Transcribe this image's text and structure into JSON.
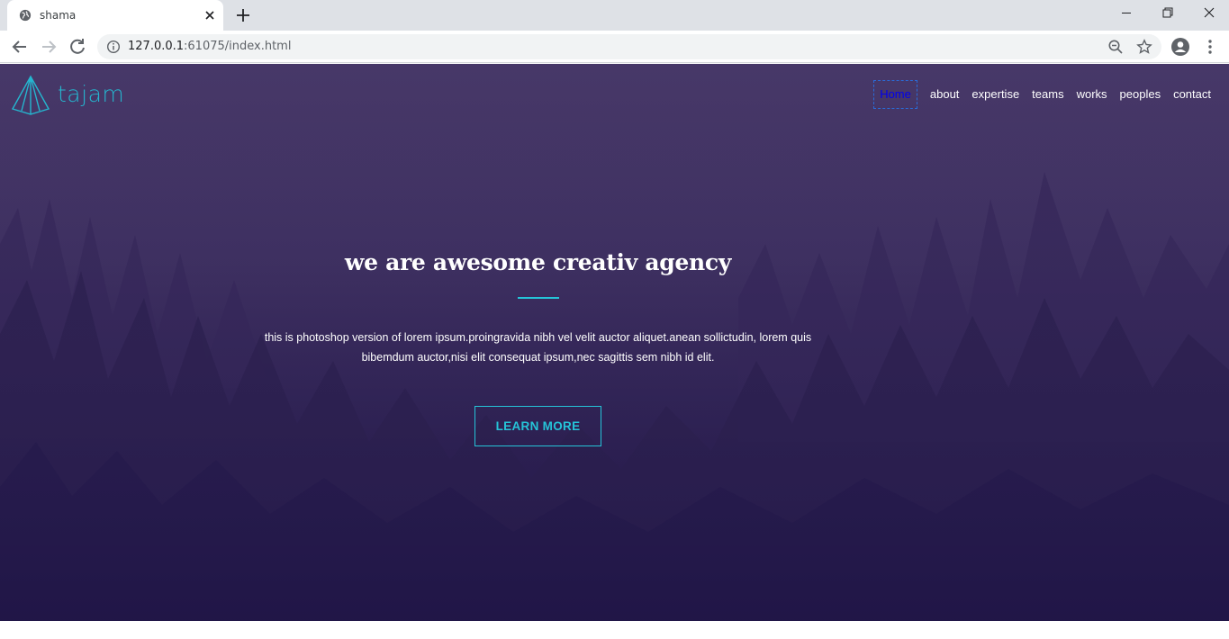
{
  "browser": {
    "tab_title": "shama",
    "url_host": "127.0.0.1",
    "url_rest": ":61075/index.html"
  },
  "icons": {
    "favicon": "globe-icon",
    "tab_close": "close-icon",
    "new_tab": "plus-icon",
    "back": "arrow-left-icon",
    "forward": "arrow-right-icon",
    "reload": "reload-icon",
    "site_info": "info-icon",
    "zoom": "zoom-out-icon",
    "bookmark": "star-icon",
    "profile": "account-icon",
    "menu": "kebab-menu-icon"
  },
  "site": {
    "logo_text": "tajam",
    "nav": [
      {
        "label": "Home",
        "active": true
      },
      {
        "label": "about"
      },
      {
        "label": "expertise"
      },
      {
        "label": "teams"
      },
      {
        "label": "works"
      },
      {
        "label": "peoples"
      },
      {
        "label": "contact"
      }
    ],
    "hero": {
      "title": "we are awesome creativ agency",
      "text_line1": "this is photoshop version of lorem ipsum.proingravida nibh vel velit auctor aliquet.anean sollictudin, lorem quis",
      "text_line2": "bibemdum auctor,nisi elit consequat ipsum,nec sagittis sem nibh id elit.",
      "button": "LEARN MORE"
    }
  },
  "colors": {
    "accent": "#25c4d8",
    "hero_bg_top": "#473868",
    "hero_bg_bottom": "#221749",
    "active_link": "#0000ee"
  }
}
